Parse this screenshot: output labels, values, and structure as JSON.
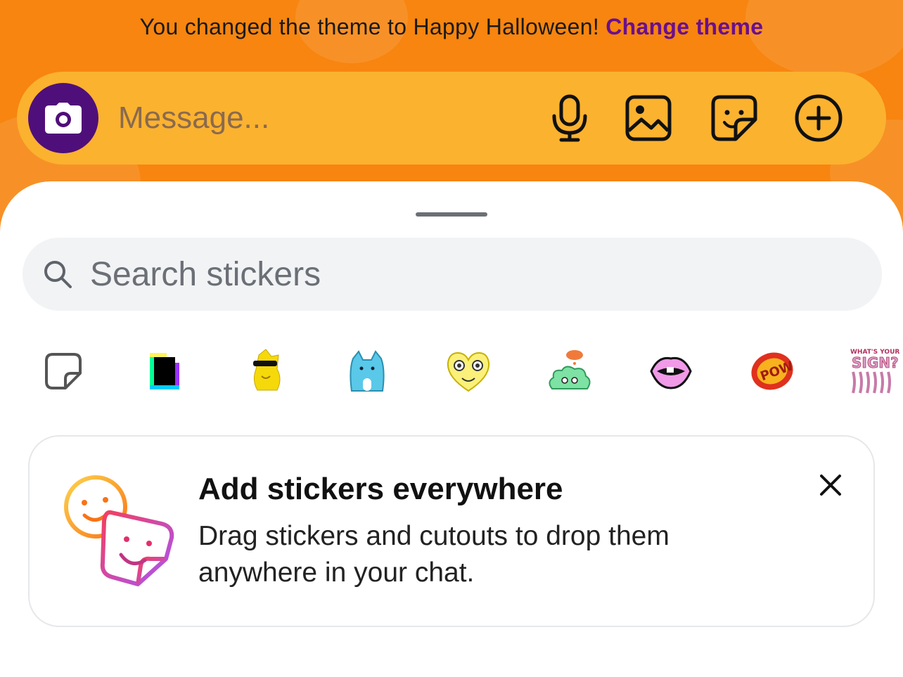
{
  "theme_notice": {
    "text": "You changed the theme to Happy Halloween!",
    "link": "Change theme"
  },
  "composer": {
    "placeholder": "Message...",
    "buttons": [
      "camera-icon",
      "microphone-icon",
      "photo-icon",
      "sticker-icon",
      "add-icon"
    ]
  },
  "sticker_sheet": {
    "search_placeholder": "Search stickers",
    "categories": [
      {
        "name": "recent-sticker-icon"
      },
      {
        "name": "giphy-sticker"
      },
      {
        "name": "yellow-dog-sunglasses-sticker"
      },
      {
        "name": "blue-cat-sticker"
      },
      {
        "name": "yellow-heart-eyes-sticker"
      },
      {
        "name": "green-cloud-sticker"
      },
      {
        "name": "pink-lips-sticker"
      },
      {
        "name": "pow-sticker"
      },
      {
        "name": "whats-your-sign-sticker",
        "text": "WHAT'S YOUR SIGN?"
      }
    ]
  },
  "promo": {
    "title": "Add stickers everywhere",
    "body": "Drag stickers and cutouts to drop them anywhere in your chat."
  },
  "colors": {
    "theme_orange": "#f7850f",
    "composer_yellow": "#fbb22f",
    "camera_purple": "#4f0f7a",
    "link_purple": "#6a0f8e"
  }
}
